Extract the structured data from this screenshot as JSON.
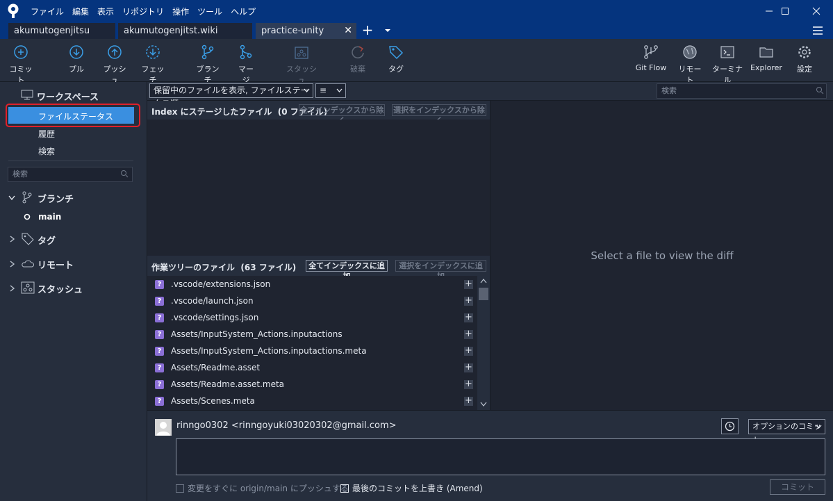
{
  "menu": [
    "ファイル",
    "編集",
    "表示",
    "リポジトリ",
    "操作",
    "ツール",
    "ヘルプ"
  ],
  "tabs": [
    {
      "label": "akumutogenjitsu",
      "active": false
    },
    {
      "label": "akumutogenjitst.wiki",
      "active": false
    },
    {
      "label": "practice-unity",
      "active": true
    }
  ],
  "toolbar": {
    "commit": "コミット",
    "pull": "プル",
    "push": "プッシュ",
    "fetch": "フェッチ",
    "branch": "ブランチ",
    "merge": "マージ",
    "stash": "スタッシュ",
    "discard": "破棄",
    "tag": "タグ",
    "gitflow": "Git Flow",
    "remote": "リモート",
    "terminal": "ターミナル",
    "explorer": "Explorer",
    "settings": "設定"
  },
  "sidebar": {
    "workspace": "ワークスペース",
    "file_status": "ファイルステータス",
    "history": "履歴",
    "search": "検索",
    "search_placeholder": "検索",
    "branches": "ブランチ",
    "current_branch": "main",
    "tags": "タグ",
    "remotes": "リモート",
    "stashes": "スタッシュ"
  },
  "filter": {
    "view_mode": "保留中のファイルを表示, ファイルステータス順",
    "list_icon": "≡",
    "search_placeholder": "検索"
  },
  "staged": {
    "title": "Index にステージしたファイル",
    "count": "(0 ファイル)",
    "remove_all": "全てインデックスから除く",
    "remove_selected": "選択をインデックスから除く"
  },
  "unstaged": {
    "title": "作業ツリーのファイル",
    "count": "(63 ファイル)",
    "add_all": "全てインデックスに追加",
    "add_selected": "選択をインデックスに追加",
    "files": [
      ".vscode/extensions.json",
      ".vscode/launch.json",
      ".vscode/settings.json",
      "Assets/InputSystem_Actions.inputactions",
      "Assets/InputSystem_Actions.inputactions.meta",
      "Assets/Readme.asset",
      "Assets/Readme.asset.meta",
      "Assets/Scenes.meta"
    ],
    "status_icon": "?"
  },
  "diff": {
    "placeholder": "Select a file to view the diff"
  },
  "commit": {
    "author": "rinngo0302 <rinngoyuki03020302@gmail.com>",
    "options": "オプションのコミット",
    "push_now": "変更をすぐに origin/main にプッシュする",
    "amend": "最後のコミットを上書き (Amend)",
    "button": "コミット"
  },
  "colors": {
    "accent": "#3a8fe0",
    "titlebar": "#05347e",
    "highlight": "#e0202a"
  }
}
